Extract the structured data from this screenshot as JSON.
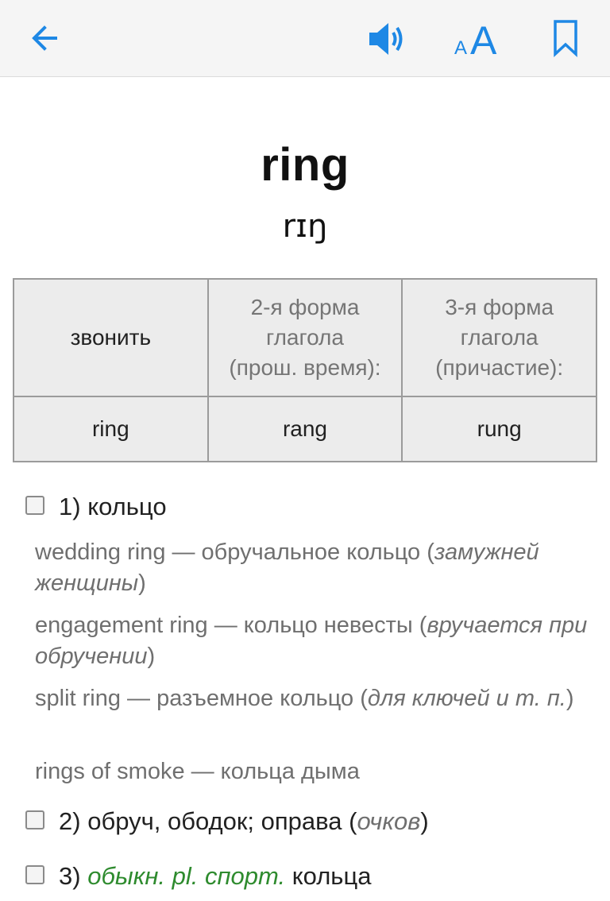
{
  "toolbar": {
    "back_icon": "arrow-left-icon",
    "sound_icon": "speaker-icon",
    "font_icon": "font-size-icon",
    "bookmark_icon": "bookmark-icon",
    "accent_color": "#1e88e5"
  },
  "entry": {
    "word": "ring",
    "transcription": "rɪŋ"
  },
  "forms_table": {
    "headers": [
      "звонить",
      "2-я форма глагола (прош. время):",
      "3-я форма глагола (причастие):"
    ],
    "header2_lines": [
      "2-я форма",
      "глагола",
      "(прош. время):"
    ],
    "header3_lines": [
      "3-я форма",
      "глагола",
      "(причастие):"
    ],
    "values": [
      "ring",
      "rang",
      "rung"
    ]
  },
  "senses": [
    {
      "number": "1)",
      "translation": "кольцо",
      "examples": [
        {
          "text": "wedding ring — обручальное кольцо (",
          "note": "замужней женщины",
          "close": ")"
        },
        {
          "text": "engagement ring — кольцо невесты (",
          "note": "вручается при обручении",
          "close": ")"
        },
        {
          "text": "split ring — разъемное кольцо (",
          "note": "для ключей и т. п.",
          "close": ")"
        },
        {
          "text": "rings of smoke — кольца дыма"
        }
      ]
    },
    {
      "number": "2)",
      "translation": "обруч, ободок; оправа (",
      "note": "очков",
      "close": ")"
    },
    {
      "number": "3)",
      "label": "обыкн. pl. спорт.",
      "translation": "кольца",
      "label_color": "#2e8b2e"
    }
  ]
}
